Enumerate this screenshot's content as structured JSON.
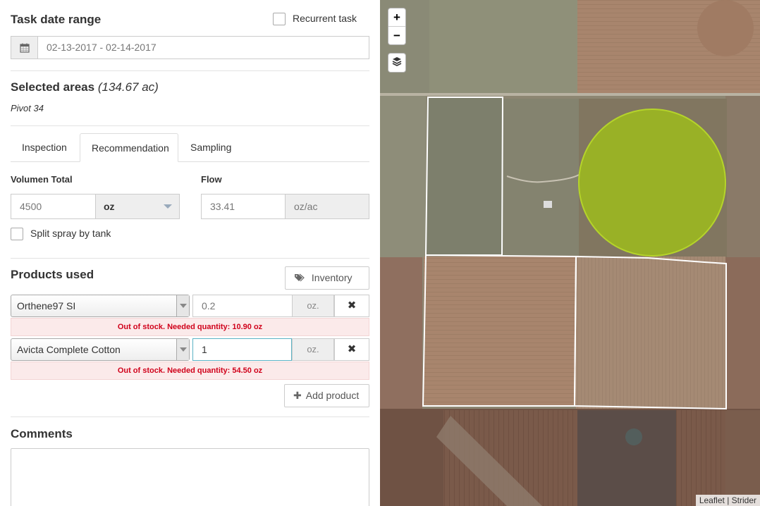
{
  "task": {
    "date_range_title": "Task date range",
    "date_range_value": "02-13-2017 - 02-14-2017",
    "recurrent_label": "Recurrent task"
  },
  "areas": {
    "title": "Selected areas",
    "acreage": "(134.67 ac)",
    "area_name": "Pivot 34"
  },
  "tabs": [
    "Inspection",
    "Recommendation",
    "Sampling"
  ],
  "active_tab": "Recommendation",
  "volume": {
    "label": "Volumen Total",
    "value": "4500",
    "unit": "oz"
  },
  "flow": {
    "label": "Flow",
    "value": "33.41",
    "unit": "oz/ac"
  },
  "split_label": "Split spray by tank",
  "products": {
    "title": "Products used",
    "inventory_label": "Inventory",
    "add_label": "Add product",
    "items": [
      {
        "name": "Orthene97 SI",
        "quantity": "0.2",
        "unit": "oz.",
        "error": "Out of stock. Needed quantity: 10.90 oz"
      },
      {
        "name": "Avicta Complete Cotton",
        "quantity": "1",
        "unit": "oz.",
        "error": "Out of stock. Needed quantity: 54.50 oz"
      }
    ]
  },
  "comments": {
    "title": "Comments"
  },
  "map": {
    "zoom_in": "+",
    "zoom_out": "−",
    "attribution_leaflet": "Leaflet",
    "attribution_sep": "|",
    "attribution_provider": "Strider",
    "selected_fill": "#9ebc1c",
    "field_outline": "#ffffff"
  },
  "colors": {
    "error_text": "#d0021b",
    "focus_border": "#5bb2c4"
  }
}
